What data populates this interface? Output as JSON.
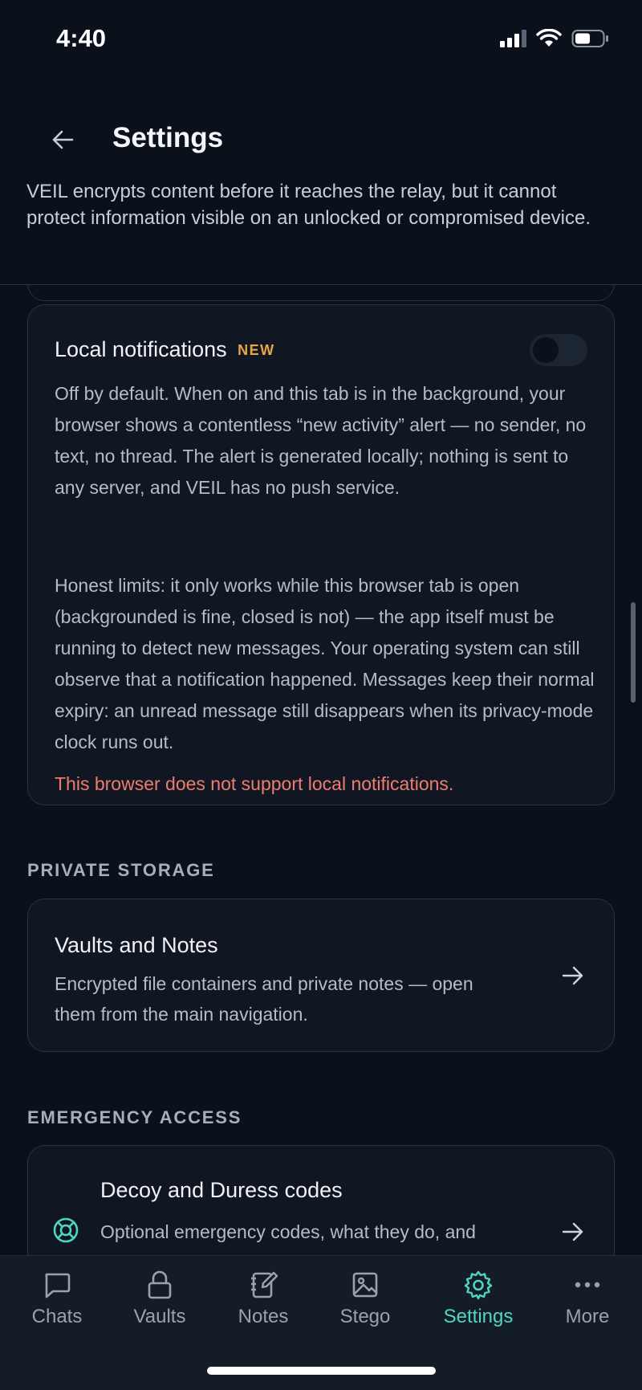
{
  "status_bar": {
    "time": "4:40"
  },
  "header": {
    "title": "Settings",
    "intro": "VEIL encrypts content before it reaches the relay, but it cannot protect information visible on an unlocked or compromised device."
  },
  "notifications_card": {
    "title": "Local notifications",
    "badge": "NEW",
    "toggle_on": false,
    "paragraph1": "Off by default. When on and this tab is in the background, your browser shows a contentless “new activity” alert — no sender, no text, no thread. The alert is generated locally; nothing is sent to any server, and VEIL has no push service.",
    "paragraph2": "Honest limits: it only works while this browser tab is open (backgrounded is fine, closed is not) — the app itself must be running to detect new messages. Your operating system can still observe that a notification happened. Messages keep their normal expiry: an unread message still disappears when its privacy-mode clock runs out.",
    "error": "This browser does not support local notifications."
  },
  "sections": {
    "private_storage": {
      "label": "PRIVATE STORAGE",
      "item_title": "Vaults and Notes",
      "item_desc": "Encrypted file containers and private notes — open them from the main navigation."
    },
    "emergency_access": {
      "label": "EMERGENCY ACCESS",
      "item_title": "Decoy and Duress codes",
      "item_desc": "Optional emergency codes, what they do, and"
    }
  },
  "bottom_nav": {
    "items": [
      {
        "label": "Chats",
        "icon": "chat-bubble-icon"
      },
      {
        "label": "Vaults",
        "icon": "lock-icon"
      },
      {
        "label": "Notes",
        "icon": "notebook-icon"
      },
      {
        "label": "Stego",
        "icon": "image-icon"
      },
      {
        "label": "Settings",
        "icon": "gear-icon",
        "active": true
      },
      {
        "label": "More",
        "icon": "more-dots-icon"
      }
    ]
  },
  "colors": {
    "background": "#0b111b",
    "card": "#101722",
    "accent": "#4fd6c0",
    "badge": "#e8a54a",
    "error": "#ef7d6f"
  }
}
